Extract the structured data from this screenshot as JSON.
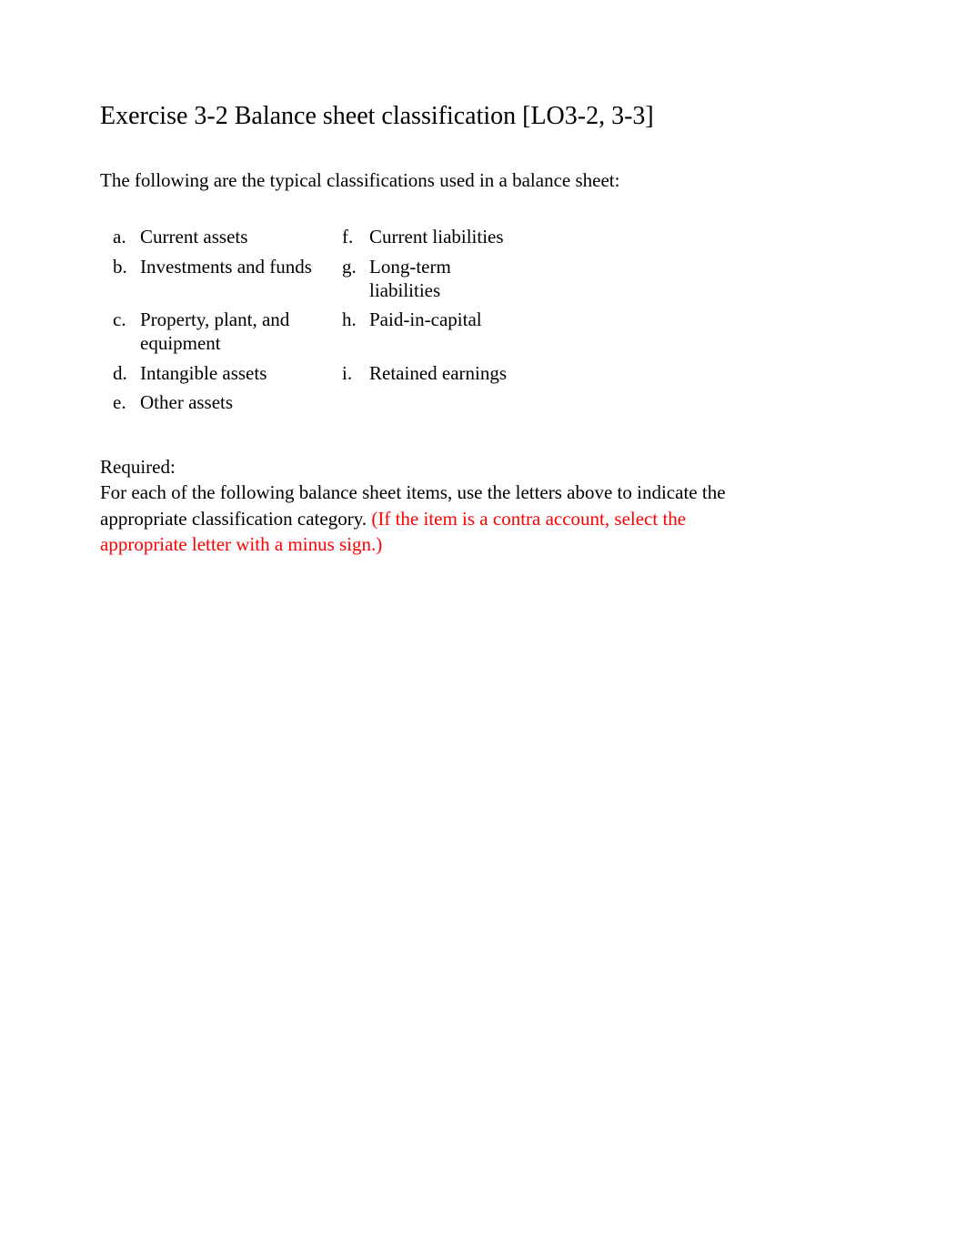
{
  "title": "Exercise 3-2 Balance sheet classification [LO3-2, 3-3]",
  "intro": "The following are the typical classifications used in a balance sheet:",
  "classifications": {
    "a_letter": "a.",
    "a_label": "Current assets",
    "b_letter": "b.",
    "b_label": "Investments and funds",
    "c_letter": "c.",
    "c_label": "Property, plant, and equipment",
    "d_letter": "d.",
    "d_label": "Intangible assets",
    "e_letter": "e.",
    "e_label": "Other assets",
    "f_letter": "f.",
    "f_label": "Current liabilities",
    "g_letter": "g.",
    "g_label": "Long-term liabilities",
    "h_letter": "h.",
    "h_label": "Paid-in-capital",
    "i_letter": "i.",
    "i_label": "Retained earnings"
  },
  "required_label": "Required:",
  "required_text": "For each of the following balance sheet items, use the letters above to indicate the appropriate classification category.",
  "required_red": "(If the item is a contra account, select the appropriate letter with a minus sign.)"
}
